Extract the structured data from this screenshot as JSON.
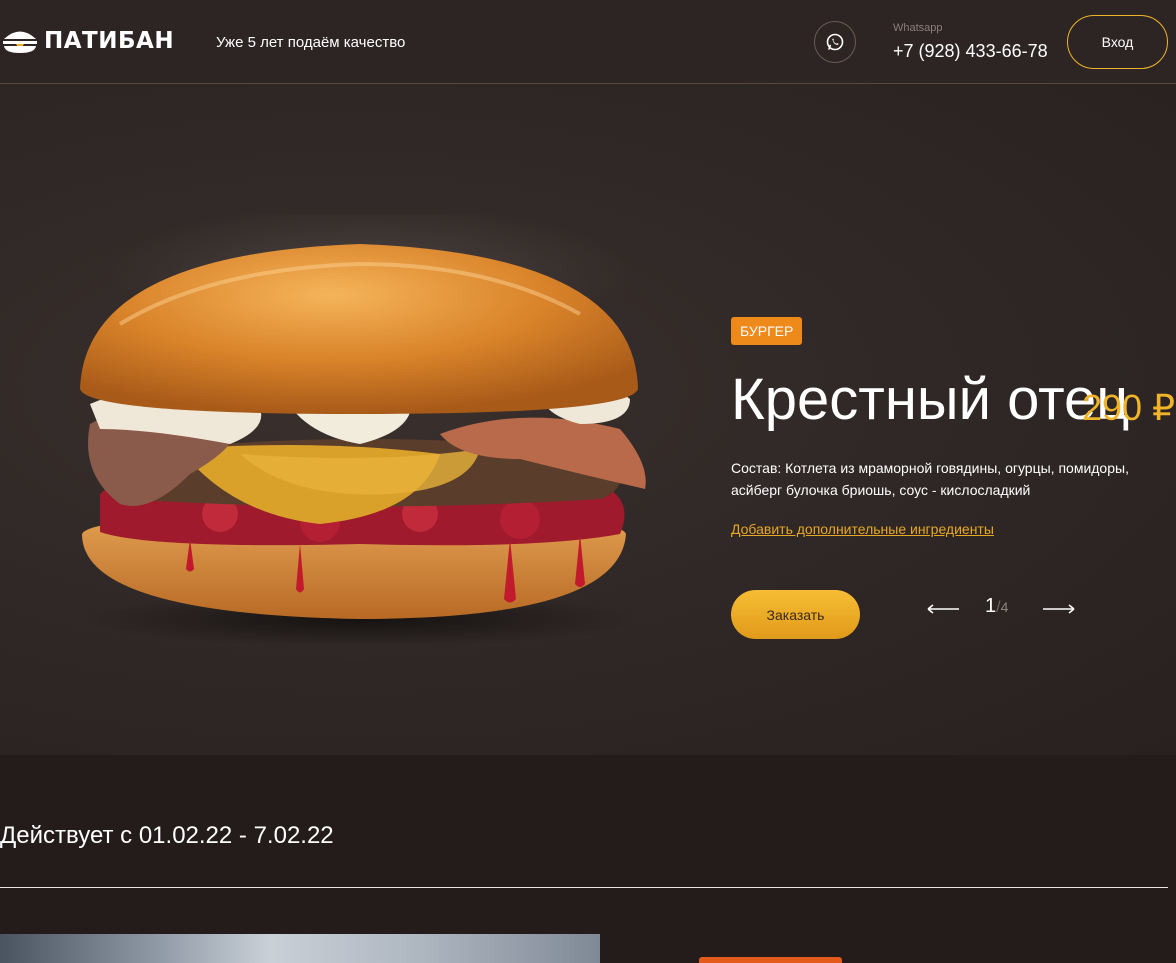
{
  "header": {
    "brand": "ПАТИБАН",
    "tagline": "Уже 5 лет подаём качество",
    "whatsapp_label": "Whatsapp",
    "phone": "+7 (928) 433-66-78",
    "login_label": "Вход"
  },
  "product": {
    "category": "БУРГЕР",
    "name": "Крестный отец",
    "price": "290 ₽",
    "composition": "Состав: Котлета из мраморной говядины, огурцы, помидоры, асйберг булочка бриошь, соус - кислосладкий",
    "add_ingredients": "Добавить дополнительные ингредиенты",
    "order_label": "Заказать"
  },
  "slider": {
    "current": "1",
    "separator": "/",
    "total": "4"
  },
  "promo": {
    "validity": "Действует с 01.02.22 - 7.02.22"
  },
  "colors": {
    "accent": "#f0b429",
    "tag": "#ee8a1a",
    "background": "#2a2222"
  }
}
